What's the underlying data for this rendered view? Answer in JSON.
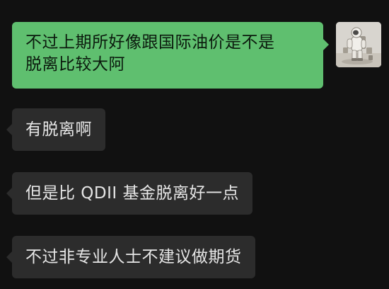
{
  "chat": {
    "messages": [
      {
        "sender": "self",
        "lines": [
          "不过上期所好像跟国际油价是不是",
          "脱离比较大阿"
        ]
      },
      {
        "sender": "other",
        "text": "有脱离啊"
      },
      {
        "sender": "other",
        "text": "但是比 QDII 基金脱离好一点"
      },
      {
        "sender": "other",
        "text": "不过非专业人士不建议做期货"
      }
    ],
    "avatar_icon": "astronaut-photo-avatar"
  },
  "colors": {
    "background": "#111111",
    "sent_bubble": "#5fbf6f",
    "received_bubble": "#2c2c2c",
    "received_text": "#e6e6e6"
  }
}
